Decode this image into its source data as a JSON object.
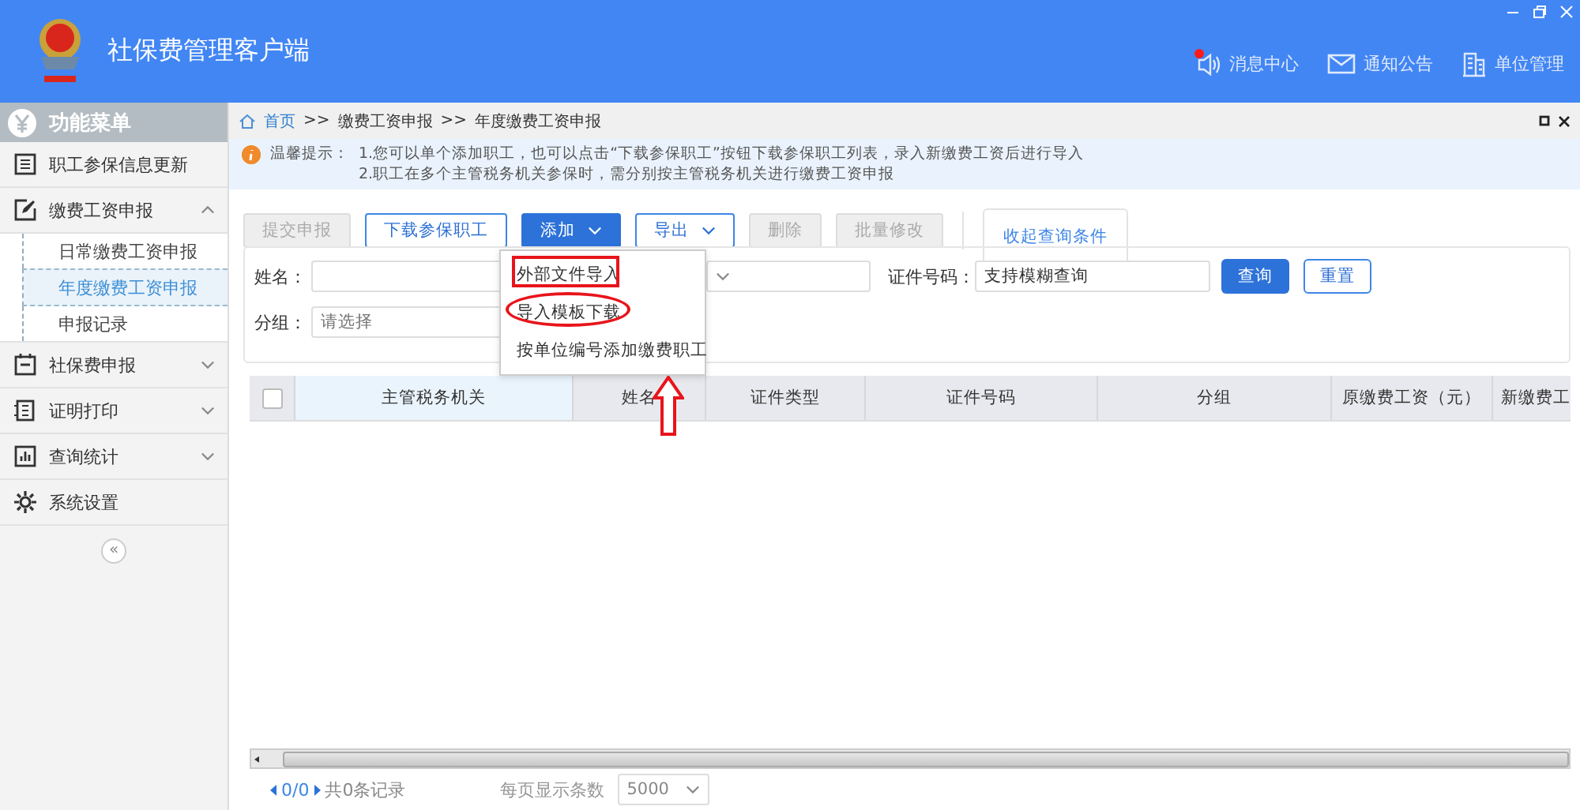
{
  "window": {
    "title": "社保费管理客户端"
  },
  "header_links": [
    {
      "kind": "message",
      "label": "消息中心",
      "unread": true
    },
    {
      "kind": "notice",
      "label": "通知公告"
    },
    {
      "kind": "unit",
      "label": "单位管理"
    }
  ],
  "sidebar": {
    "title": "功能菜单",
    "items": [
      {
        "kind": "table",
        "label": "职工参保信息更新"
      },
      {
        "kind": "edit",
        "label": "缴费工资申报",
        "expanded": true,
        "children": [
          {
            "label": "日常缴费工资申报",
            "selected": false
          },
          {
            "label": "年度缴费工资申报",
            "selected": true
          },
          {
            "label": "申报记录",
            "selected": false
          }
        ]
      },
      {
        "kind": "calendar",
        "label": "社保费申报",
        "expanded": false
      },
      {
        "kind": "print",
        "label": "证明打印",
        "expanded": false
      },
      {
        "kind": "chart",
        "label": "查询统计",
        "expanded": false
      },
      {
        "kind": "gear",
        "label": "系统设置"
      }
    ],
    "collapse": "«"
  },
  "breadcrumb": [
    "首页",
    "缴费工资申报",
    "年度缴费工资申报"
  ],
  "breadcrumb_separator": ">>",
  "notice": {
    "label": "温馨提示：",
    "lines": [
      "1.您可以单个添加职工，也可以点击“下载参保职工”按钮下载参保职工列表，录入新缴费工资后进行导入",
      "2.职工在多个主管税务机关参保时，需分别按主管税务机关进行缴费工资申报"
    ]
  },
  "toolbar": [
    {
      "kind": "button",
      "label": "提交申报",
      "disabled": true
    },
    {
      "kind": "outline",
      "label": "下载参保职工",
      "disabled": false
    },
    {
      "kind": "primary-menu",
      "label": "添加",
      "disabled": false
    },
    {
      "kind": "outline-menu",
      "label": "导出",
      "disabled": false
    },
    {
      "kind": "button",
      "label": "删除",
      "disabled": true
    },
    {
      "kind": "button",
      "label": "批量修改",
      "disabled": true
    }
  ],
  "filter_tab": "收起查询条件",
  "add_menu": [
    {
      "label": "外部文件导入",
      "kind": "boxed"
    },
    {
      "label": "导入模板下载",
      "kind": "circled"
    },
    {
      "label": "按单位编号添加缴费职工",
      "kind": "pointed"
    }
  ],
  "filters": {
    "name_label": "姓名：",
    "id_label": "证件号码：",
    "id_value": "支持模糊查询",
    "group_label": "分组：",
    "group_placeholder": "请选择",
    "search": "查询",
    "reset": "重置"
  },
  "table": {
    "checked": false,
    "columns": [
      {
        "label": "主管税务机关",
        "selected": true
      },
      {
        "label": "姓名",
        "selected": false
      },
      {
        "label": "证件类型",
        "selected": false
      },
      {
        "label": "证件号码",
        "selected": false
      },
      {
        "label": "分组",
        "selected": false
      },
      {
        "label": "原缴费工资（元）",
        "selected": false
      },
      {
        "label": "新缴费工",
        "selected": false
      }
    ]
  },
  "pager": {
    "pages": "0/0",
    "total": "共0条记录",
    "page_size_label": "每页显示条数",
    "page_size": "5000"
  }
}
